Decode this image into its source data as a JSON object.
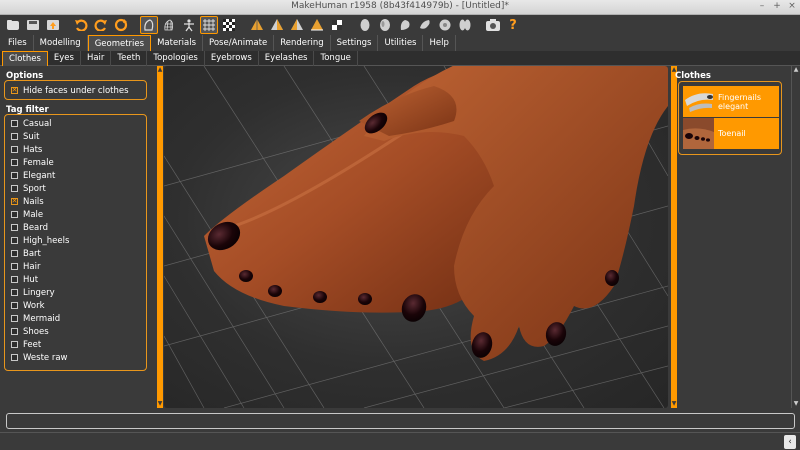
{
  "window": {
    "title": "MakeHuman r1958 (8b43f414979b) - [Untitled]*",
    "controls": [
      "–",
      "+",
      "×"
    ]
  },
  "toolbar": {
    "icons": [
      "folder-icon",
      "save-icon",
      "export-icon",
      "undo-icon",
      "redo-icon",
      "reset-icon",
      "smooth-icon",
      "wireframe-icon",
      "pose-icon",
      "grid-icon",
      "checker-icon",
      "front-view-icon",
      "back-view-icon",
      "side-view-icon",
      "left-view-icon",
      "top-view-icon",
      "face-icon",
      "head-icon",
      "leg-icon",
      "foot-icon",
      "hand-icon",
      "torso-icon",
      "screenshot-icon",
      "help-icon"
    ]
  },
  "main_tabs": [
    "Files",
    "Modelling",
    "Geometries",
    "Materials",
    "Pose/Animate",
    "Rendering",
    "Settings",
    "Utilities",
    "Help"
  ],
  "main_tab_active": "Geometries",
  "sub_tabs": [
    "Clothes",
    "Eyes",
    "Hair",
    "Teeth",
    "Topologies",
    "Eyebrows",
    "Eyelashes",
    "Tongue"
  ],
  "sub_tab_active": "Clothes",
  "options": {
    "title": "Options",
    "hide_faces": {
      "label": "Hide faces under clothes",
      "checked": true
    }
  },
  "tag_filter": {
    "title": "Tag filter",
    "tags": [
      {
        "label": "Casual",
        "checked": false
      },
      {
        "label": "Suit",
        "checked": false
      },
      {
        "label": "Hats",
        "checked": false
      },
      {
        "label": "Female",
        "checked": false
      },
      {
        "label": "Elegant",
        "checked": false
      },
      {
        "label": "Sport",
        "checked": false
      },
      {
        "label": "Nails",
        "checked": true
      },
      {
        "label": "Male",
        "checked": false
      },
      {
        "label": "Beard",
        "checked": false
      },
      {
        "label": "High_heels",
        "checked": false
      },
      {
        "label": "Bart",
        "checked": false
      },
      {
        "label": "Hair",
        "checked": false
      },
      {
        "label": "Hut",
        "checked": false
      },
      {
        "label": "Lingery",
        "checked": false
      },
      {
        "label": "Work",
        "checked": false
      },
      {
        "label": "Mermaid",
        "checked": false
      },
      {
        "label": "Shoes",
        "checked": false
      },
      {
        "label": "Feet",
        "checked": false
      },
      {
        "label": "Weste raw",
        "checked": false
      }
    ]
  },
  "clothes": {
    "title": "Clothes",
    "items": [
      {
        "label": "Fingernails elegant",
        "icon": "fingernails-thumbnail"
      },
      {
        "label": "Toenail",
        "icon": "toenail-thumbnail"
      }
    ]
  },
  "colors": {
    "accent": "#ff9900",
    "background": "#3a3a3a",
    "skin": "#b0582f",
    "nail": "#1a0408"
  }
}
